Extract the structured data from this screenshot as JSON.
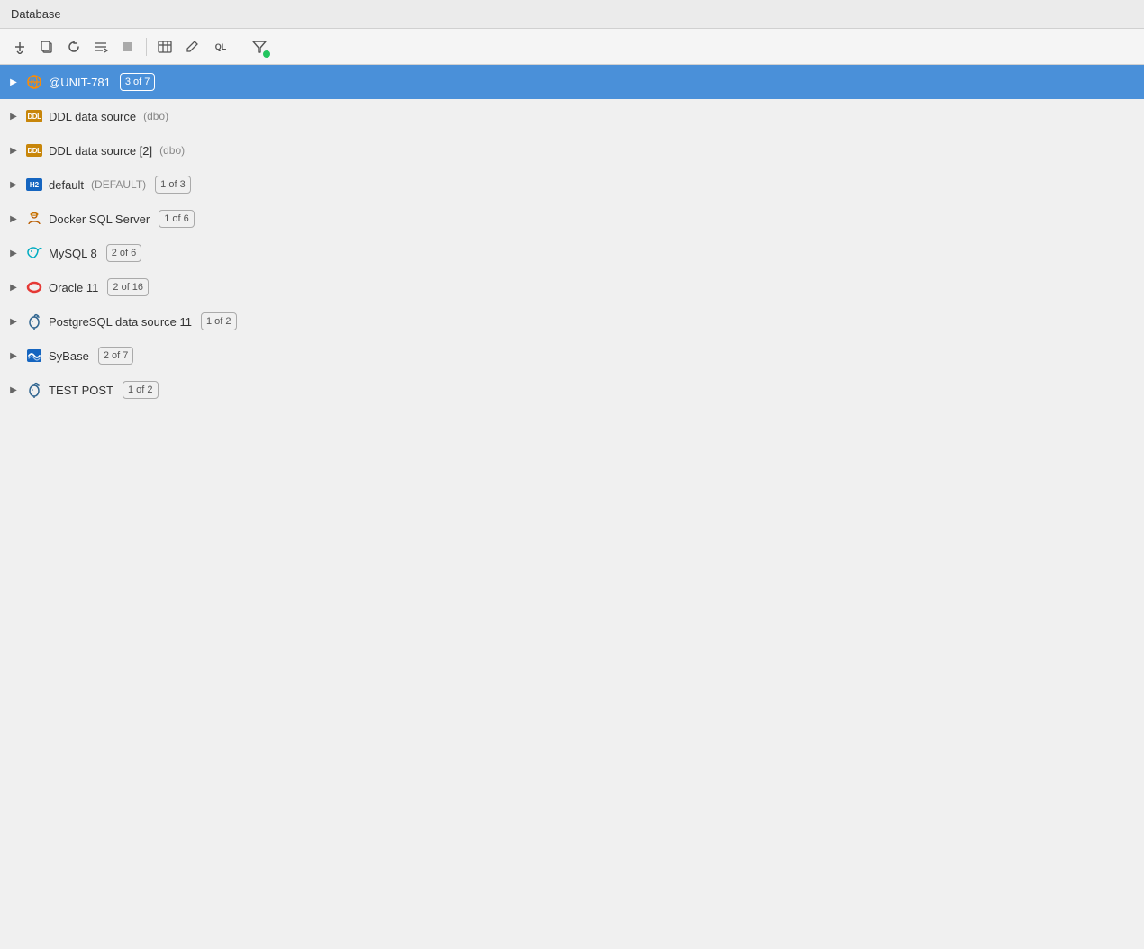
{
  "panel": {
    "title": "Database",
    "toolbar": {
      "buttons": [
        {
          "name": "add-button",
          "label": "+↓",
          "symbol": "⊕",
          "interactable": true
        },
        {
          "name": "copy-button",
          "symbol": "⧉",
          "interactable": true
        },
        {
          "name": "refresh-button",
          "symbol": "↻",
          "interactable": true
        },
        {
          "name": "schema-button",
          "symbol": "≋",
          "interactable": true
        },
        {
          "name": "stop-button",
          "symbol": "■",
          "interactable": true
        },
        {
          "name": "table-button",
          "symbol": "⊞",
          "interactable": true
        },
        {
          "name": "edit-button",
          "symbol": "✎",
          "interactable": true
        },
        {
          "name": "sql-button",
          "symbol": "QL",
          "interactable": true
        },
        {
          "name": "filter-button",
          "symbol": "⊽",
          "interactable": true,
          "has_dot": true
        }
      ]
    },
    "selected_item": "@UNIT-781",
    "selected_badge": "3 of 7",
    "tree_items": [
      {
        "id": "unit-781",
        "label": "@UNIT-781",
        "badge": "3 of 7",
        "icon_type": "server-orange",
        "selected": true,
        "sub_label": ""
      },
      {
        "id": "ddl-1",
        "label": "DDL data source",
        "badge": "",
        "icon_type": "ddl",
        "selected": false,
        "sub_label": "(dbo)"
      },
      {
        "id": "ddl-2",
        "label": "DDL data source [2]",
        "badge": "",
        "icon_type": "ddl",
        "selected": false,
        "sub_label": "(dbo)"
      },
      {
        "id": "default",
        "label": "default",
        "badge": "1 of 3",
        "icon_type": "h2",
        "selected": false,
        "sub_label": "(DEFAULT)"
      },
      {
        "id": "docker-sql",
        "label": "Docker SQL Server",
        "badge": "1 of 6",
        "icon_type": "sql-server",
        "selected": false,
        "sub_label": ""
      },
      {
        "id": "mysql8",
        "label": "MySQL 8",
        "badge": "2 of 6",
        "icon_type": "mysql",
        "selected": false,
        "sub_label": ""
      },
      {
        "id": "oracle11",
        "label": "Oracle 11",
        "badge": "2 of 16",
        "icon_type": "oracle",
        "selected": false,
        "sub_label": ""
      },
      {
        "id": "postgresql11",
        "label": "PostgreSQL data source 11",
        "badge": "1 of 2",
        "icon_type": "postgresql",
        "selected": false,
        "sub_label": ""
      },
      {
        "id": "sybase",
        "label": "SyBase",
        "badge": "2 of 7",
        "icon_type": "sybase",
        "selected": false,
        "sub_label": ""
      },
      {
        "id": "testpost",
        "label": "TEST POST",
        "badge": "1 of 2",
        "icon_type": "postgresql",
        "selected": false,
        "sub_label": ""
      }
    ]
  }
}
